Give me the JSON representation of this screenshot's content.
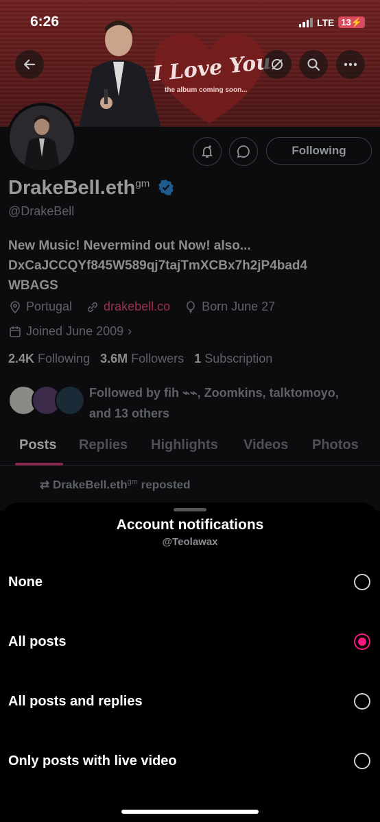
{
  "status_bar": {
    "time": "6:26",
    "network": "LTE",
    "battery": "13"
  },
  "banner": {
    "title": "I Love You",
    "subtitle": "the album coming soon..."
  },
  "header": {
    "back_icon": "arrow-left-icon",
    "icons": [
      "hide-icon",
      "search-icon",
      "more-icon"
    ]
  },
  "profile": {
    "actions": {
      "bell_icon": "bell-icon",
      "message_icon": "message-icon",
      "follow_label": "Following"
    },
    "name": "DrakeBell.eth",
    "name_sup": "gm",
    "handle": "@DrakeBell",
    "bio_line1": "New Music! Nevermind out Now! also...",
    "bio_line2": "DxCaJCCQYf845W589qj7tajTmXCBx7h2jP4bad4",
    "bio_line3": "WBAGS",
    "location": "Portugal",
    "website": "drakebell.co",
    "birthday": "Born June 27",
    "joined": "Joined June 2009",
    "following_count": "2.4K",
    "following_label": "Following",
    "followers_count": "3.6M",
    "followers_label": "Followers",
    "subscription_count": "1",
    "subscription_label": "Subscription",
    "followed_by": "Followed by fih ⌁⌁, Zoomkins, talktomoyo,",
    "followed_by_2": "and 13 others"
  },
  "tabs": [
    "Posts",
    "Replies",
    "Highlights",
    "Videos",
    "Photos"
  ],
  "active_tab": "Posts",
  "repost_text": "DrakeBell.eth",
  "repost_sup": "gm",
  "repost_suffix": "reposted",
  "sheet": {
    "title": "Account notifications",
    "subtitle": "@Teolawax",
    "options": [
      {
        "label": "None",
        "selected": false
      },
      {
        "label": "All posts",
        "selected": true
      },
      {
        "label": "All posts and replies",
        "selected": false
      },
      {
        "label": "Only posts with live video",
        "selected": false
      }
    ]
  },
  "colors": {
    "accent": "#f91880",
    "sheet_bg": "#000000"
  }
}
